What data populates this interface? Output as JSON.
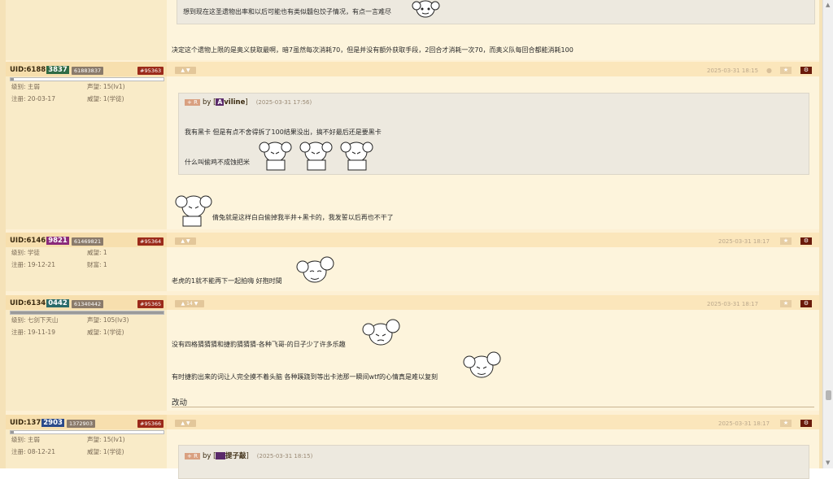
{
  "prev_post": {
    "quote_text": "想到现在这圣遗物出率和以后可能也有类似髓包饺子情况，有点一言难尽",
    "body_text": "决定这个遗物上限的是奥义获取最啊，暗7虽然每次消耗70，但是并没有额外获取手段，2回合才消耗一次70，而奥义队每回合都能消耗100"
  },
  "posts": [
    {
      "uid_prefix": "UID:6188",
      "uid_hl": "3837",
      "uid_full": "61883837",
      "post_no": "#95363",
      "level": "主弱",
      "prestige": "15(lv1)",
      "register": "20-03-17",
      "authority": "1(学徒)",
      "date": "2025-03-31 18:15",
      "quote": {
        "tag": "R",
        "by": "by [",
        "user_badge": "A",
        "user": "viline",
        "close": "]",
        "date": "(2025-03-31 17:56)",
        "line1": "我有黑卡 但是有点不舍得拆了100结果没出，搞不好最后还是要黑卡",
        "line2": "什么叫偷鸡不成蚀把米"
      },
      "body": "倩兔就是这样白白偷掉我半井+黑卡的，我发誓以后再也不干了"
    },
    {
      "uid_prefix": "UID:6146",
      "uid_hl": "9821",
      "uid_full": "61469821",
      "post_no": "#95364",
      "level": "学徒",
      "prestige": "1",
      "register": "19-12-21",
      "wealth_label": "财富:",
      "wealth": "1",
      "date": "2025-03-31 18:17",
      "body": "老虎的1就不能再下一起拍嗨 好抱时間"
    },
    {
      "uid_prefix": "UID:6134",
      "uid_hl": "0442",
      "uid_full": "61340442",
      "post_no": "#95365",
      "level": "七剑下天山",
      "prestige": "105(lv3)",
      "register": "19-11-19",
      "authority": "1(学徒)",
      "vote": "14",
      "date": "2025-03-31 18:17",
      "line1": "没有四格猜猜猜和捷豹猜猜猜-各种飞哥-的日子少了许多乐趣",
      "line2": "有时捷豹出来的词让人完全摸不着头脑 各种蹊跷到等出卡池那一瞬间wtf的心情真是难以复刻",
      "edit_label": "改动"
    },
    {
      "uid_prefix": "UID:137",
      "uid_hl": "2903",
      "uid_full": "1372903",
      "post_no": "#95366",
      "level": "主弱",
      "prestige": "15(lv1)",
      "register": "08-12-21",
      "authority": "1(学徒)",
      "date": "2025-03-31 18:17",
      "quote": {
        "tag": "R",
        "by": "by [",
        "user_badge": " ",
        "user": "提子敲",
        "close": "]",
        "date": "(2025-03-31 18:15)"
      }
    }
  ],
  "labels": {
    "level": "级别:",
    "prestige": "声望:",
    "register": "注册:",
    "authority": "威望:",
    "plus": "+"
  },
  "colors": {
    "uid_green": "#2f6b45",
    "uid_magenta": "#8a2a7a",
    "uid_teal": "#2a6a6a",
    "uid_blue": "#2a4a8a"
  },
  "icons": [
    "thumb-up-icon",
    "thumb-down-icon",
    "android-icon",
    "star-icon",
    "gear-icon",
    "sticker-face"
  ]
}
